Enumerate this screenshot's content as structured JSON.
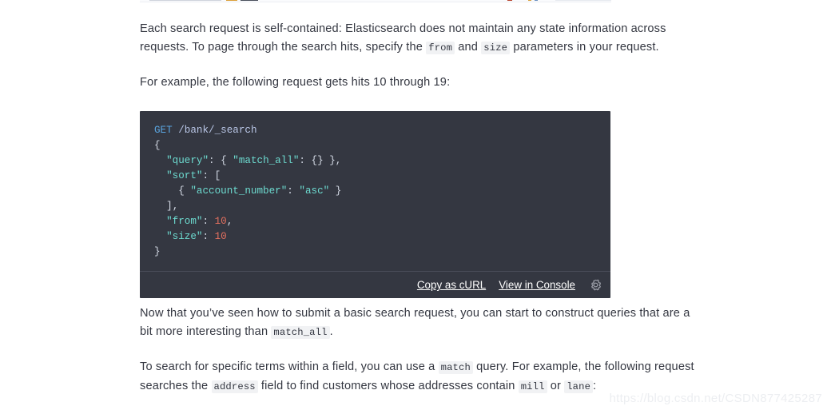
{
  "paragraphs": {
    "p1_a": "Each search request is self-contained: Elasticsearch does not maintain any state information across requests. To page through the search hits, specify the ",
    "p1_code1": "from",
    "p1_b": " and ",
    "p1_code2": "size",
    "p1_c": " parameters in your request.",
    "p2": "For example, the following request gets hits 10 through 19:",
    "p3_a": "Now that you’ve seen how to submit a basic search request, you can start to construct queries that are a bit more interesting than ",
    "p3_code1": "match_all",
    "p3_b": ".",
    "p4_a": "To search for specific terms within a field, you can use a ",
    "p4_code1": "match",
    "p4_b": " query. For example, the following request searches the ",
    "p4_code2": "address",
    "p4_c": " field to find customers whose addresses contain ",
    "p4_code3": "mill",
    "p4_d": " or ",
    "p4_code4": "lane",
    "p4_e": ":"
  },
  "code_block": {
    "method": "GET",
    "path": "/bank/_search",
    "lines": [
      "{",
      "  \"query\": { \"match_all\": {} },",
      "  \"sort\": [",
      "    { \"account_number\": \"asc\" }",
      "  ],",
      "  \"from\": 10,",
      "  \"size\": 10",
      "}"
    ],
    "tokens": {
      "brace_open": "{",
      "brace_close": "}",
      "bracket_open": "[",
      "bracket_close": "]",
      "comma": ",",
      "colon": ":",
      "empty_object": "{}",
      "key_query": "\"query\"",
      "key_match_all": "\"match_all\"",
      "key_sort": "\"sort\"",
      "key_account_number": "\"account_number\"",
      "val_asc": "\"asc\"",
      "key_from": "\"from\"",
      "key_size": "\"size\"",
      "num_from": "10",
      "num_size": "10"
    },
    "footer": {
      "copy_as_curl": "Copy as cURL",
      "view_in_console": "View in Console",
      "settings_icon": "gear-icon"
    },
    "colors": {
      "background": "#343741",
      "method": "#5aa5e0",
      "path": "#b9c6e6",
      "string": "#6ddbd0",
      "number": "#e4705f",
      "punctuation": "#d4dae5",
      "divider": "#494d59",
      "link": "#ffffff"
    }
  },
  "watermark": {
    "text": "https://blog.csdn.net/CSDN877425287"
  },
  "theme": {
    "page_background": "#ffffff",
    "body_text": "#343741",
    "inline_code_background": "#f1f2f4"
  }
}
